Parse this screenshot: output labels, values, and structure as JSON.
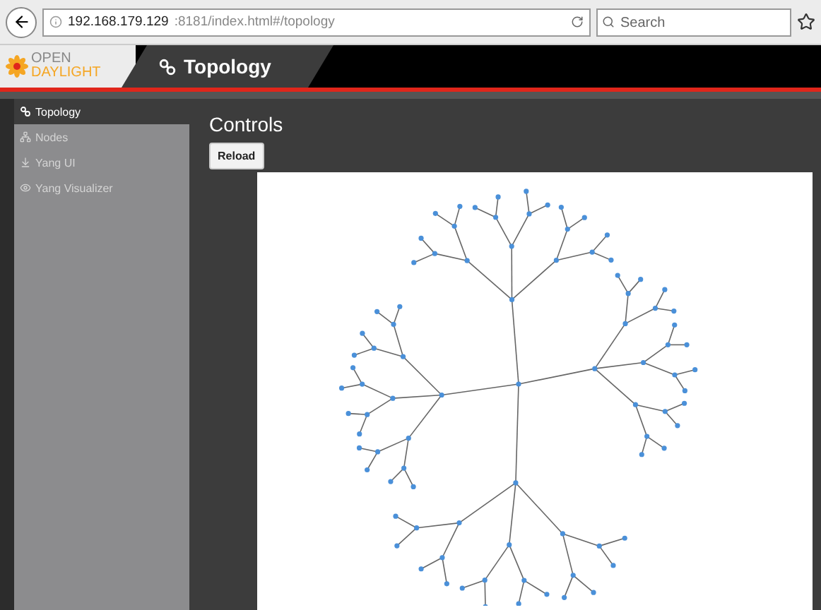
{
  "browser": {
    "url_host": "192.168.179.129",
    "url_rest": ":8181/index.html#/topology",
    "search": {
      "placeholder": "Search"
    }
  },
  "header": {
    "logo": [
      "OPEN",
      "DAYLIGHT"
    ],
    "title": "Topology"
  },
  "sidebar": {
    "items": [
      {
        "label": "Topology",
        "kind": "topology",
        "selected": true
      },
      {
        "label": "Nodes",
        "kind": "nodes",
        "selected": false
      },
      {
        "label": "Yang UI",
        "kind": "yang",
        "selected": false
      },
      {
        "label": "Yang Visualizer",
        "kind": "eye",
        "selected": false
      }
    ]
  },
  "main": {
    "heading": "Controls",
    "button": "Reload"
  }
}
